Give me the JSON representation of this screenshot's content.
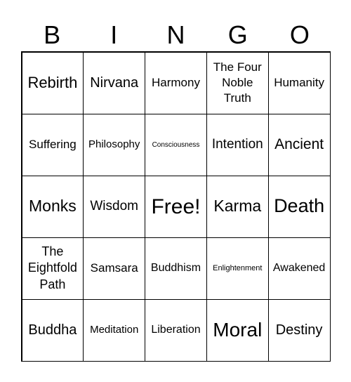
{
  "header": {
    "letters": [
      "B",
      "I",
      "N",
      "G",
      "O"
    ]
  },
  "cells": [
    "Rebirth",
    "Nirvana",
    "Harmony",
    "The Four Noble Truth",
    "Humanity",
    "Suffering",
    "Philosophy",
    "Consciousness",
    "Intention",
    "Ancient",
    "Monks",
    "Wisdom",
    "Free!",
    "Karma",
    "Death",
    "The Eightfold Path",
    "Samsara",
    "Buddhism",
    "Enlightenment",
    "Awakened",
    "Buddha",
    "Meditation",
    "Liberation",
    "Moral",
    "Destiny"
  ]
}
